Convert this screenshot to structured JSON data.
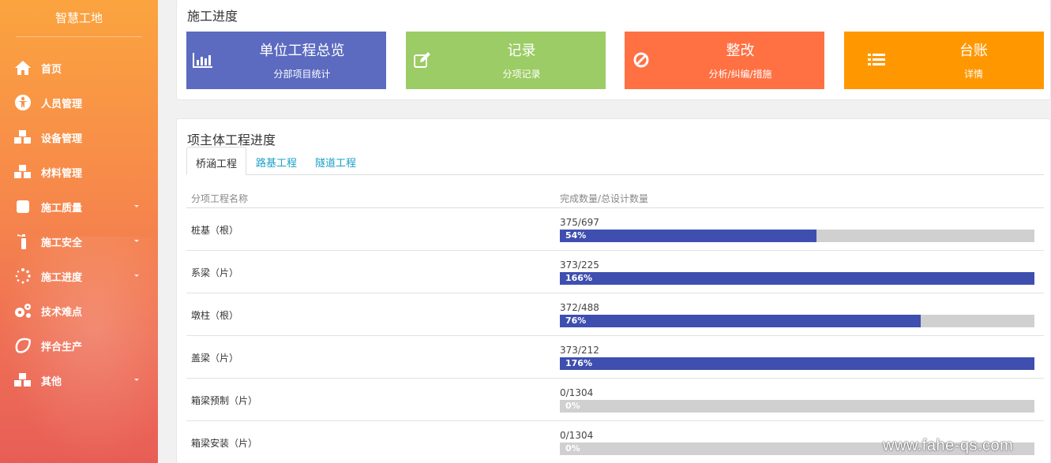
{
  "brand": "智慧工地",
  "sidebar": {
    "items": [
      {
        "label": "首页",
        "icon": "home-icon",
        "has_caret": false
      },
      {
        "label": "人员管理",
        "icon": "person-circle-icon",
        "has_caret": false
      },
      {
        "label": "设备管理",
        "icon": "cubes-icon",
        "has_caret": false
      },
      {
        "label": "材料管理",
        "icon": "cubes-icon",
        "has_caret": false
      },
      {
        "label": "施工质量",
        "icon": "square-icon",
        "has_caret": true
      },
      {
        "label": "施工安全",
        "icon": "fire-extinguisher-icon",
        "has_caret": true
      },
      {
        "label": "施工进度",
        "icon": "spinner-icon",
        "has_caret": true
      },
      {
        "label": "技术难点",
        "icon": "gears-icon",
        "has_caret": false
      },
      {
        "label": "拌合生产",
        "icon": "swirl-icon",
        "has_caret": false
      },
      {
        "label": "其他",
        "icon": "cubes-icon",
        "has_caret": true
      }
    ]
  },
  "progress_panel": {
    "title": "施工进度",
    "cards": [
      {
        "title": "单位工程总览",
        "subtitle": "分部项目统计",
        "icon": "bar-chart-icon",
        "color": "#5c6bc0"
      },
      {
        "title": "记录",
        "subtitle": "分项记录",
        "icon": "edit-icon",
        "color": "#9ccc65"
      },
      {
        "title": "整改",
        "subtitle": "分析/纠编/措施",
        "icon": "ban-icon",
        "color": "#ff7043"
      },
      {
        "title": "台账",
        "subtitle": "详情",
        "icon": "list-icon",
        "color": "#ff9800"
      }
    ]
  },
  "main_panel": {
    "title": "项主体工程进度",
    "tabs": [
      {
        "label": "桥涵工程",
        "active": true
      },
      {
        "label": "路基工程",
        "active": false
      },
      {
        "label": "隧道工程",
        "active": false
      }
    ],
    "columns": [
      "分项工程名称",
      "完成数量/总设计数量"
    ],
    "rows": [
      {
        "name": "桩基（根）",
        "count": "375/697",
        "percent": 54,
        "percent_label": "54%"
      },
      {
        "name": "系梁（片）",
        "count": "373/225",
        "percent": 166,
        "percent_label": "166%"
      },
      {
        "name": "墩柱（根）",
        "count": "372/488",
        "percent": 76,
        "percent_label": "76%"
      },
      {
        "name": "盖梁（片）",
        "count": "373/212",
        "percent": 176,
        "percent_label": "176%"
      },
      {
        "name": "箱梁预制（片）",
        "count": "0/1304",
        "percent": 0,
        "percent_label": "0%"
      },
      {
        "name": "箱梁安装（片）",
        "count": "0/1304",
        "percent": 0,
        "percent_label": "0%"
      }
    ],
    "bar_color": "#3e4fb0"
  },
  "watermark": "www.fahe-qs.com"
}
